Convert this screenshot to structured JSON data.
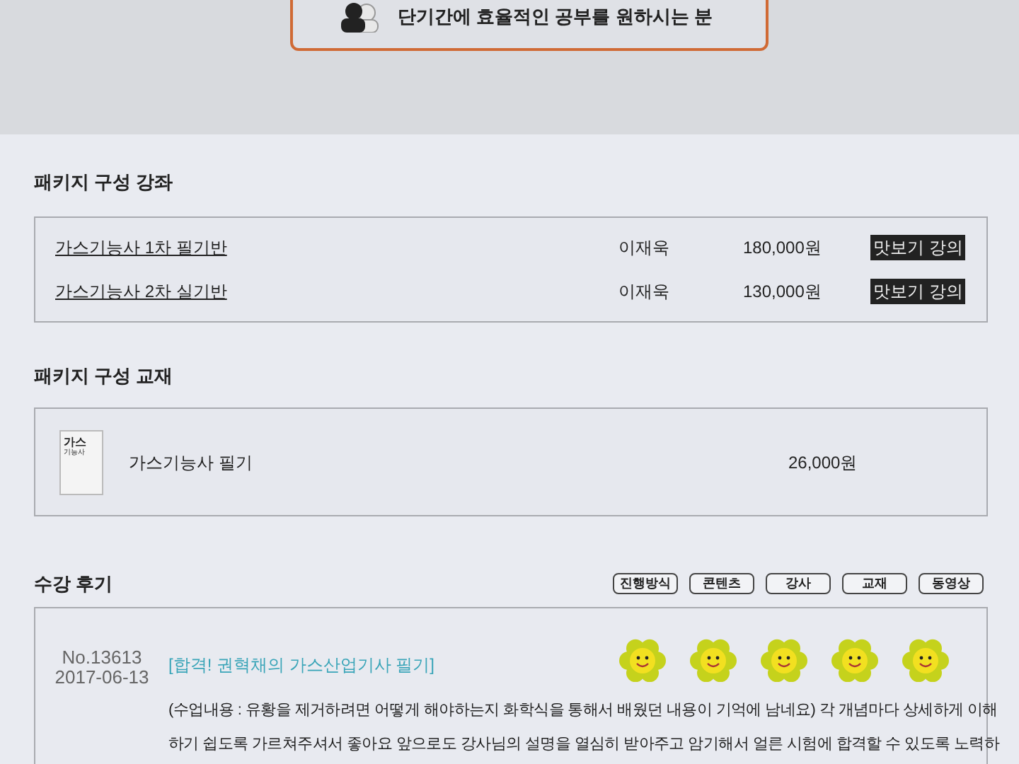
{
  "banner": {
    "text": "단기간에 효율적인 공부를 원하시는 분"
  },
  "courses": {
    "title": "패키지 구성 강좌",
    "rows": [
      {
        "name": "가스기능사 1차 필기반",
        "teacher": "이재욱",
        "price": "180,000원",
        "button": "맛보기 강의"
      },
      {
        "name": "가스기능사 2차 실기반",
        "teacher": "이재욱",
        "price": "130,000원",
        "button": "맛보기 강의"
      }
    ]
  },
  "books": {
    "title": "패키지 구성 교재",
    "rows": [
      {
        "cover": {
          "title": "가스",
          "subtitle": "기능사"
        },
        "name": "가스기능사 필기",
        "price": "26,000원"
      }
    ]
  },
  "reviews": {
    "title": "수강 후기",
    "filters": [
      "진행방식",
      "콘텐츠",
      "강사",
      "교재",
      "동영상"
    ],
    "items": [
      {
        "number": "No.13613",
        "date": "2017-06-13",
        "title": "[합격! 권혁채의 가스산업기사 필기]",
        "stars": 5,
        "body": [
          "(수업내용 : 유황을 제거하려면 어떻게 해야하는지 화학식을 통해서 배웠던 내용이 기억에 남네요) 각 개념마다 상세하게 이해",
          "하기 쉽도록 가르쳐주셔서 좋아요 앞으로도 강사님의 설명을 열심히 받아주고 암기해서 얼른 시험에 합격할 수 있도록 노력하"
        ]
      }
    ]
  }
}
